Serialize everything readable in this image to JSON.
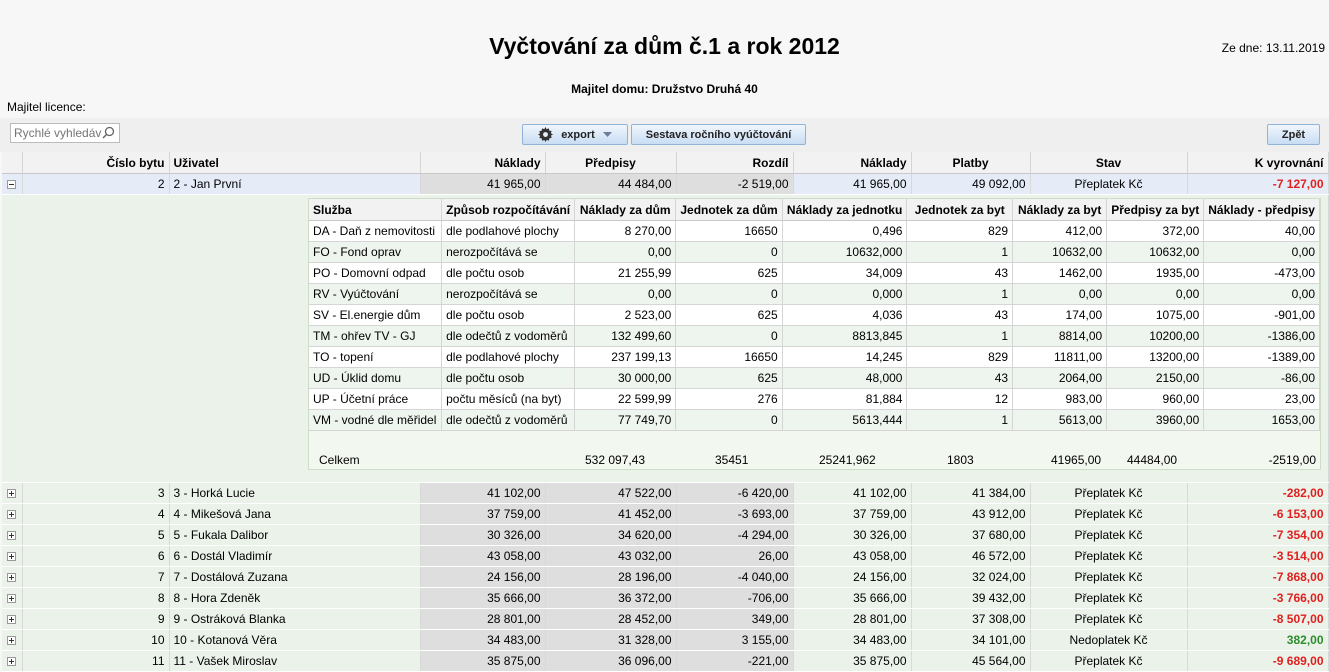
{
  "header": {
    "title": "Vyčtování za dům č.1 a rok 2012",
    "date": "Ze dne: 13.11.2019",
    "owner": "Majitel domu: Družstvo Druhá 40",
    "licence": "Majitel licence:"
  },
  "toolbar": {
    "search_placeholder": "Rychlé vyhledávání",
    "export_label": "export",
    "report_label": "Sestava ročního vyúčtování",
    "back_label": "Zpět"
  },
  "columns": [
    "Číslo bytu",
    "Uživatel",
    "Náklady",
    "Předpisy",
    "Rozdíl",
    "Náklady",
    "Platby",
    "Stav",
    "K vyrovnání"
  ],
  "rows": [
    {
      "num": "2",
      "user": "2 - Jan První",
      "cost": "41 965,00",
      "pre": "44 484,00",
      "diff": "-2 519,00",
      "cost2": "41 965,00",
      "pay": "49 092,00",
      "state": "Přeplatek Kč",
      "bal": "-7 127,00",
      "neg": true,
      "expanded": true
    },
    {
      "num": "3",
      "user": "3 - Horká Lucie",
      "cost": "41 102,00",
      "pre": "47 522,00",
      "diff": "-6 420,00",
      "cost2": "41 102,00",
      "pay": "41 384,00",
      "state": "Přeplatek Kč",
      "bal": "-282,00",
      "neg": true
    },
    {
      "num": "4",
      "user": "4 - Mikešová Jana",
      "cost": "37 759,00",
      "pre": "41 452,00",
      "diff": "-3 693,00",
      "cost2": "37 759,00",
      "pay": "43 912,00",
      "state": "Přeplatek Kč",
      "bal": "-6 153,00",
      "neg": true
    },
    {
      "num": "5",
      "user": "5 - Fukala Dalibor",
      "cost": "30 326,00",
      "pre": "34 620,00",
      "diff": "-4 294,00",
      "cost2": "30 326,00",
      "pay": "37 680,00",
      "state": "Přeplatek Kč",
      "bal": "-7 354,00",
      "neg": true
    },
    {
      "num": "6",
      "user": "6 - Dostál Vladimír",
      "cost": "43 058,00",
      "pre": "43 032,00",
      "diff": "26,00",
      "cost2": "43 058,00",
      "pay": "46 572,00",
      "state": "Přeplatek Kč",
      "bal": "-3 514,00",
      "neg": true
    },
    {
      "num": "7",
      "user": "7 - Dostálová Zuzana",
      "cost": "24 156,00",
      "pre": "28 196,00",
      "diff": "-4 040,00",
      "cost2": "24 156,00",
      "pay": "32 024,00",
      "state": "Přeplatek Kč",
      "bal": "-7 868,00",
      "neg": true
    },
    {
      "num": "8",
      "user": "8 - Hora Zdeněk",
      "cost": "35 666,00",
      "pre": "36 372,00",
      "diff": "-706,00",
      "cost2": "35 666,00",
      "pay": "39 432,00",
      "state": "Přeplatek Kč",
      "bal": "-3 766,00",
      "neg": true
    },
    {
      "num": "9",
      "user": "9 - Ostráková Blanka",
      "cost": "28 801,00",
      "pre": "28 452,00",
      "diff": "349,00",
      "cost2": "28 801,00",
      "pay": "37 308,00",
      "state": "Přeplatek Kč",
      "bal": "-8 507,00",
      "neg": true
    },
    {
      "num": "10",
      "user": "10 - Kotanová Věra",
      "cost": "34 483,00",
      "pre": "31 328,00",
      "diff": "3 155,00",
      "cost2": "34 483,00",
      "pay": "34 101,00",
      "state": "Nedoplatek Kč",
      "bal": "382,00",
      "neg": false
    },
    {
      "num": "11",
      "user": "11 - Vašek Miroslav",
      "cost": "35 875,00",
      "pre": "36 096,00",
      "diff": "-221,00",
      "cost2": "35 875,00",
      "pay": "45 564,00",
      "state": "Přeplatek Kč",
      "bal": "-9 689,00",
      "neg": true
    }
  ],
  "detail": {
    "columns": [
      "Služba",
      "Způsob rozpočítávání",
      "Náklady za dům",
      "Jednotek za dům",
      "Náklady za jednotku",
      "Jednotek za byt",
      "Náklady za byt",
      "Předpisy za byt",
      "Náklady - předpisy"
    ],
    "rows": [
      [
        "DA - Daň z nemovitosti",
        "dle podlahové plochy",
        "8 270,00",
        "16650",
        "0,496",
        "829",
        "412,00",
        "372,00",
        "40,00"
      ],
      [
        "FO - Fond oprav",
        "nerozpočítává se",
        "0,00",
        "0",
        "10632,000",
        "1",
        "10632,00",
        "10632,00",
        "0,00"
      ],
      [
        "PO - Domovní odpad",
        "dle počtu osob",
        "21 255,99",
        "625",
        "34,009",
        "43",
        "1462,00",
        "1935,00",
        "-473,00"
      ],
      [
        "RV - Vyúčtování",
        "nerozpočítává se",
        "0,00",
        "0",
        "0,000",
        "1",
        "0,00",
        "0,00",
        "0,00"
      ],
      [
        "SV - El.energie dům",
        "dle počtu osob",
        "2 523,00",
        "625",
        "4,036",
        "43",
        "174,00",
        "1075,00",
        "-901,00"
      ],
      [
        "TM - ohřev TV - GJ",
        "dle odečtů z vodoměrů",
        "132 499,60",
        "0",
        "8813,845",
        "1",
        "8814,00",
        "10200,00",
        "-1386,00"
      ],
      [
        "TO - topení",
        "dle podlahové plochy",
        "237 199,13",
        "16650",
        "14,245",
        "829",
        "11811,00",
        "13200,00",
        "-1389,00"
      ],
      [
        "UD - Úklid domu",
        "dle počtu osob",
        "30 000,00",
        "625",
        "48,000",
        "43",
        "2064,00",
        "2150,00",
        "-86,00"
      ],
      [
        "UP - Účetní práce",
        "počtu měsíců (na byt)",
        "22 599,99",
        "276",
        "81,884",
        "12",
        "983,00",
        "960,00",
        "23,00"
      ],
      [
        "VM - vodné dle měřidel",
        "dle odečtů z vodoměrů",
        "77 749,70",
        "0",
        "5613,444",
        "1",
        "5613,00",
        "3960,00",
        "1653,00"
      ]
    ],
    "total": {
      "label": "Celkem",
      "house_cost": "532 097,43",
      "house_units": "35451",
      "unit_cost": "25241,962",
      "flat_units": "1803",
      "flat_cost": "41965,00",
      "flat_pre": "44484,00",
      "diff": "-2519,00"
    }
  }
}
